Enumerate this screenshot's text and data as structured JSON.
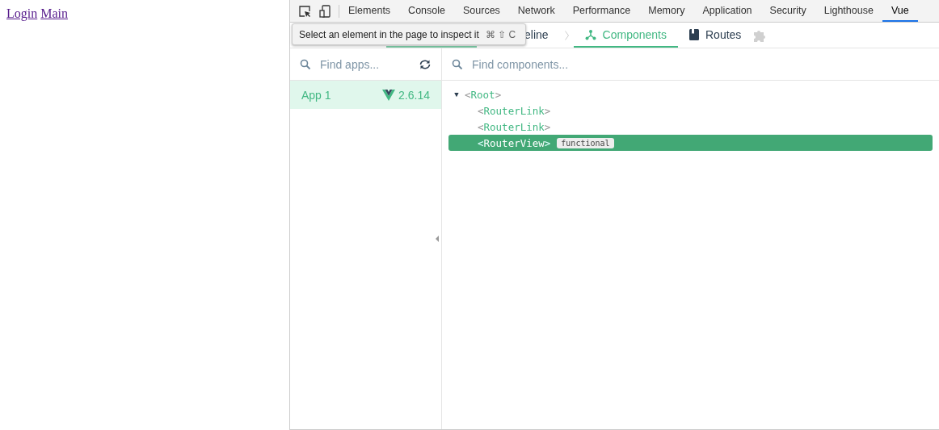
{
  "page_links": [
    "Login",
    "Main"
  ],
  "devtools_tabs": [
    {
      "label": "Elements",
      "selected": false
    },
    {
      "label": "Console",
      "selected": false
    },
    {
      "label": "Sources",
      "selected": false
    },
    {
      "label": "Network",
      "selected": false
    },
    {
      "label": "Performance",
      "selected": false
    },
    {
      "label": "Memory",
      "selected": false
    },
    {
      "label": "Application",
      "selected": false
    },
    {
      "label": "Security",
      "selected": false
    },
    {
      "label": "Lighthouse",
      "selected": false
    },
    {
      "label": "Vue",
      "selected": true
    }
  ],
  "tooltip": {
    "text": "Select an element in the page to inspect it",
    "shortcut": "⌘ ⇧ C"
  },
  "vue_tabs": [
    {
      "label": "eline",
      "kind": "timeline",
      "selected": false
    },
    {
      "label": "Components",
      "kind": "components",
      "selected": true
    },
    {
      "label": "Routes",
      "kind": "routes",
      "selected": false
    }
  ],
  "apps": {
    "search": {
      "placeholder": "Find apps..."
    },
    "items": [
      {
        "name": "App 1",
        "version": "2.6.14",
        "selected": true
      }
    ]
  },
  "components": {
    "search": {
      "placeholder": "Find components..."
    },
    "tree": [
      {
        "name": "<Root>",
        "toggle": "▼",
        "expanded": true,
        "selected": false,
        "children": [
          {
            "name": "<RouterLink>",
            "selected": false
          },
          {
            "name": "<RouterLink>",
            "selected": false
          },
          {
            "name": "<RouterView>",
            "selected": true,
            "tag": "functional"
          }
        ]
      }
    ]
  }
}
